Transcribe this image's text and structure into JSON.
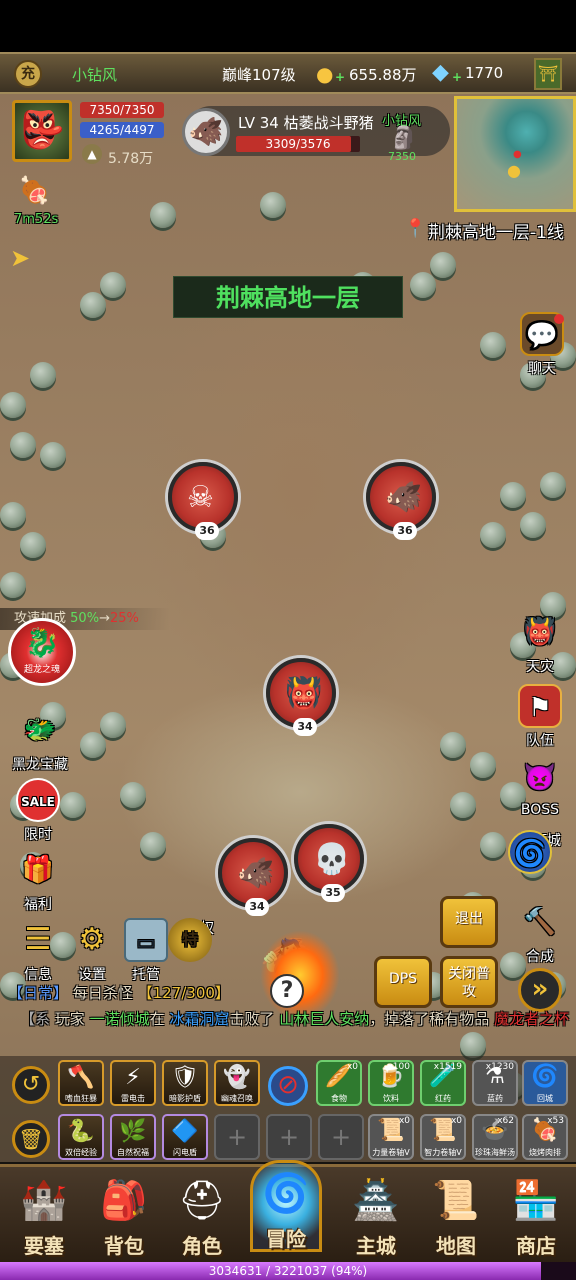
{
  "topbar": {
    "player_name": "小钻风",
    "rank": "巅峰107级",
    "gold": "655.88万",
    "diamonds": "1770",
    "vip_glyph": "充"
  },
  "player": {
    "hp": "7350/7350",
    "mp": "4265/4497",
    "power": "5.78万",
    "buff_timer": "7m52s"
  },
  "target": {
    "name": "LV 34 枯萎战斗野猪",
    "hp": "3309/3576",
    "hp_fraction": 0.925
  },
  "party": {
    "name": "小钻风",
    "value": "7350"
  },
  "location": "荆棘高地一层-1线",
  "zone_banner": "荆棘高地一层",
  "nodes": [
    {
      "level": "36",
      "creature": "skeleton",
      "glyph": "☠"
    },
    {
      "level": "36",
      "creature": "boar",
      "glyph": "🐗"
    },
    {
      "level": "34",
      "creature": "wild-man",
      "glyph": "👹"
    },
    {
      "level": "34",
      "creature": "boar",
      "glyph": "🐗"
    },
    {
      "level": "35",
      "creature": "skeleton",
      "glyph": "💀"
    }
  ],
  "buff_text": {
    "label": "攻速加成",
    "from": "50%",
    "arrow": "→",
    "to": "25%"
  },
  "left_menu": {
    "dragon_badge": "超龙之魂",
    "black_dragon": "黑龙宝藏",
    "limited": "限时",
    "limited_badge": "SALE",
    "welfare": "福利"
  },
  "right_menu": {
    "chat": "聊天",
    "disaster": "天灾",
    "team": "队伍",
    "boss": "BOSS",
    "dungeon": "地下城",
    "craft": "合成"
  },
  "toolbar": {
    "info": "信息",
    "settings": "设置",
    "auto": "托管",
    "privilege": "特权"
  },
  "action_buttons": {
    "exit": "退出",
    "dps": "DPS",
    "close_attack": "关闭普攻"
  },
  "quest": {
    "tag": "【日常】",
    "name": "每日杀怪",
    "progress": "【127/300】"
  },
  "system_msg": {
    "tag": "【系",
    "prefix": "玩家",
    "player": "一诺倾城",
    "mid1": "在",
    "place": "冰霜洞窟",
    "mid2": "击败了",
    "boss": "山林巨人安纳",
    "mid3": "，掉落了稀有物品",
    "item": "魔龙者之杯"
  },
  "skills_row1": [
    {
      "name": "嗜血狂暴"
    },
    {
      "name": "雷电击"
    },
    {
      "name": "暗影护盾"
    },
    {
      "name": "幽魂召唤"
    }
  ],
  "skills_row2": [
    {
      "name": "双倍经验"
    },
    {
      "name": "自然祝福"
    },
    {
      "name": "闪电盾"
    }
  ],
  "items_row1": [
    {
      "name": "食物",
      "count": "x0",
      "icon": "🥖"
    },
    {
      "name": "饮料",
      "count": "x100",
      "icon": "🍺"
    },
    {
      "name": "红药",
      "count": "x1519",
      "icon": "🧪"
    },
    {
      "name": "蓝药",
      "count": "x1230",
      "icon": "⚗"
    },
    {
      "name": "回城",
      "count": "",
      "icon": "🌀"
    }
  ],
  "items_row2": [
    {
      "name": "力量卷轴V",
      "count": "x0",
      "icon": "📜"
    },
    {
      "name": "智力卷轴V",
      "count": "x0",
      "icon": "📜"
    },
    {
      "name": "珍珠海鲜汤",
      "count": "x62",
      "icon": "🍲"
    },
    {
      "name": "烧烤肉排",
      "count": "x53",
      "icon": "🍖"
    }
  ],
  "bottom_nav": [
    "要塞",
    "背包",
    "角色",
    "冒险",
    "主城",
    "地图",
    "商店"
  ],
  "bottom_icons": [
    "🏰",
    "🎒",
    "⛑",
    "🌀",
    "🏯",
    "📜",
    "🏪"
  ],
  "exp": {
    "text": "3034631 / 3221037 (94%)",
    "fraction": 0.94
  },
  "colors": {
    "accent_gold": "#f0c23a",
    "hp_red": "#c0302a",
    "mp_blue": "#3a5fc8",
    "chat_green": "#5fe05f",
    "quest_yellow": "#f0c23a",
    "exp_purple": "#b04ad8"
  }
}
